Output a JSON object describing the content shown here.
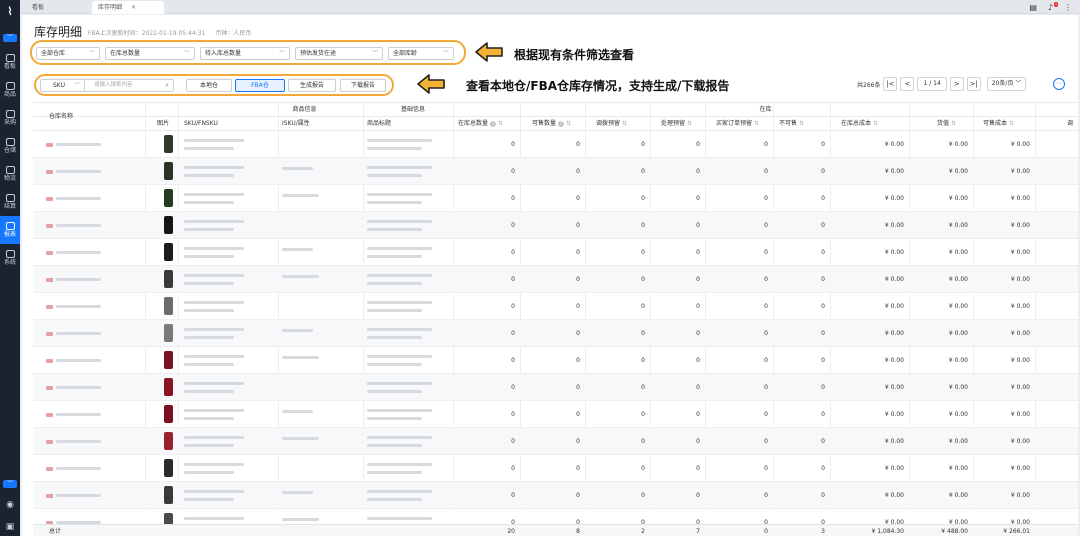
{
  "sidebar": {
    "items": [
      {
        "label": "看板",
        "icon": "dashboard-icon"
      },
      {
        "label": "商品",
        "icon": "box-icon"
      },
      {
        "label": "采购",
        "icon": "cart-icon"
      },
      {
        "label": "仓储",
        "icon": "warehouse-icon"
      },
      {
        "label": "物流",
        "icon": "truck-icon"
      },
      {
        "label": "结算",
        "icon": "coin-icon"
      },
      {
        "label": "报表",
        "icon": "chart-icon"
      },
      {
        "label": "系统",
        "icon": "settings-icon"
      }
    ],
    "active": "报表"
  },
  "tabs": [
    {
      "label": "看板"
    },
    {
      "label": "库存明细"
    }
  ],
  "page": {
    "title": "库存明细",
    "update_label": "FBA上次更新时间：",
    "update_time": "2022-01-19 05:44:31",
    "currency_label": "币种：",
    "currency": "人民币"
  },
  "filters": [
    "全部仓库",
    "在库总数量",
    "待入库总数量",
    "预估发货在途",
    "全部库龄"
  ],
  "search": {
    "type": "SKU",
    "placeholder": "请输入搜索内容"
  },
  "toggle": [
    "本地仓",
    "FBA仓"
  ],
  "toggle_active": "FBA仓",
  "actions": [
    "生成报告",
    "下载报告"
  ],
  "annotations": [
    "根据现有条件筛选查看",
    "查看本地仓/FBA仓库存情况，支持生成/下载报告"
  ],
  "pagination": {
    "total": "共266条",
    "current": "1",
    "pages": "/ 14",
    "page_size": "20条/页"
  },
  "table": {
    "group_headers": {
      "product": "商品信息",
      "basic": "基础信息",
      "stock": "在库"
    },
    "columns": {
      "warehouse": "仓库名称",
      "image": "图片",
      "sku": "SKU/FNSKU",
      "isku": "ISKU/属性",
      "product_title": "商品标题",
      "total_qty": "在库总数量",
      "available": "可售数量",
      "transfer": "调拨预留",
      "processing": "处理预留",
      "buyer_order": "买家订单预留",
      "unsellable": "不可售",
      "total_cost": "在库总成本",
      "goods_value": "货值",
      "sellable_cost": "可售成本",
      "tail": "调"
    },
    "row_values": {
      "total_qty": "0",
      "available": "0",
      "transfer": "0",
      "processing": "0",
      "buyer_order": "0",
      "unsellable": "0",
      "total_cost": "¥ 0.00",
      "goods_value": "¥ 0.00",
      "sellable_cost": "¥ 0.00"
    },
    "row_count": 15,
    "footer": {
      "label": "总计",
      "total_qty": "20",
      "available": "8",
      "transfer": "2",
      "processing": "7",
      "buyer_order": "0",
      "unsellable": "3",
      "total_cost": "¥ 1,084.30",
      "goods_value": "¥ 488.00",
      "sellable_cost": "¥ 266.01"
    }
  },
  "colors": {
    "accent": "#1677ff",
    "highlight": "#f3a93a",
    "sidebar": "#1b2331"
  }
}
